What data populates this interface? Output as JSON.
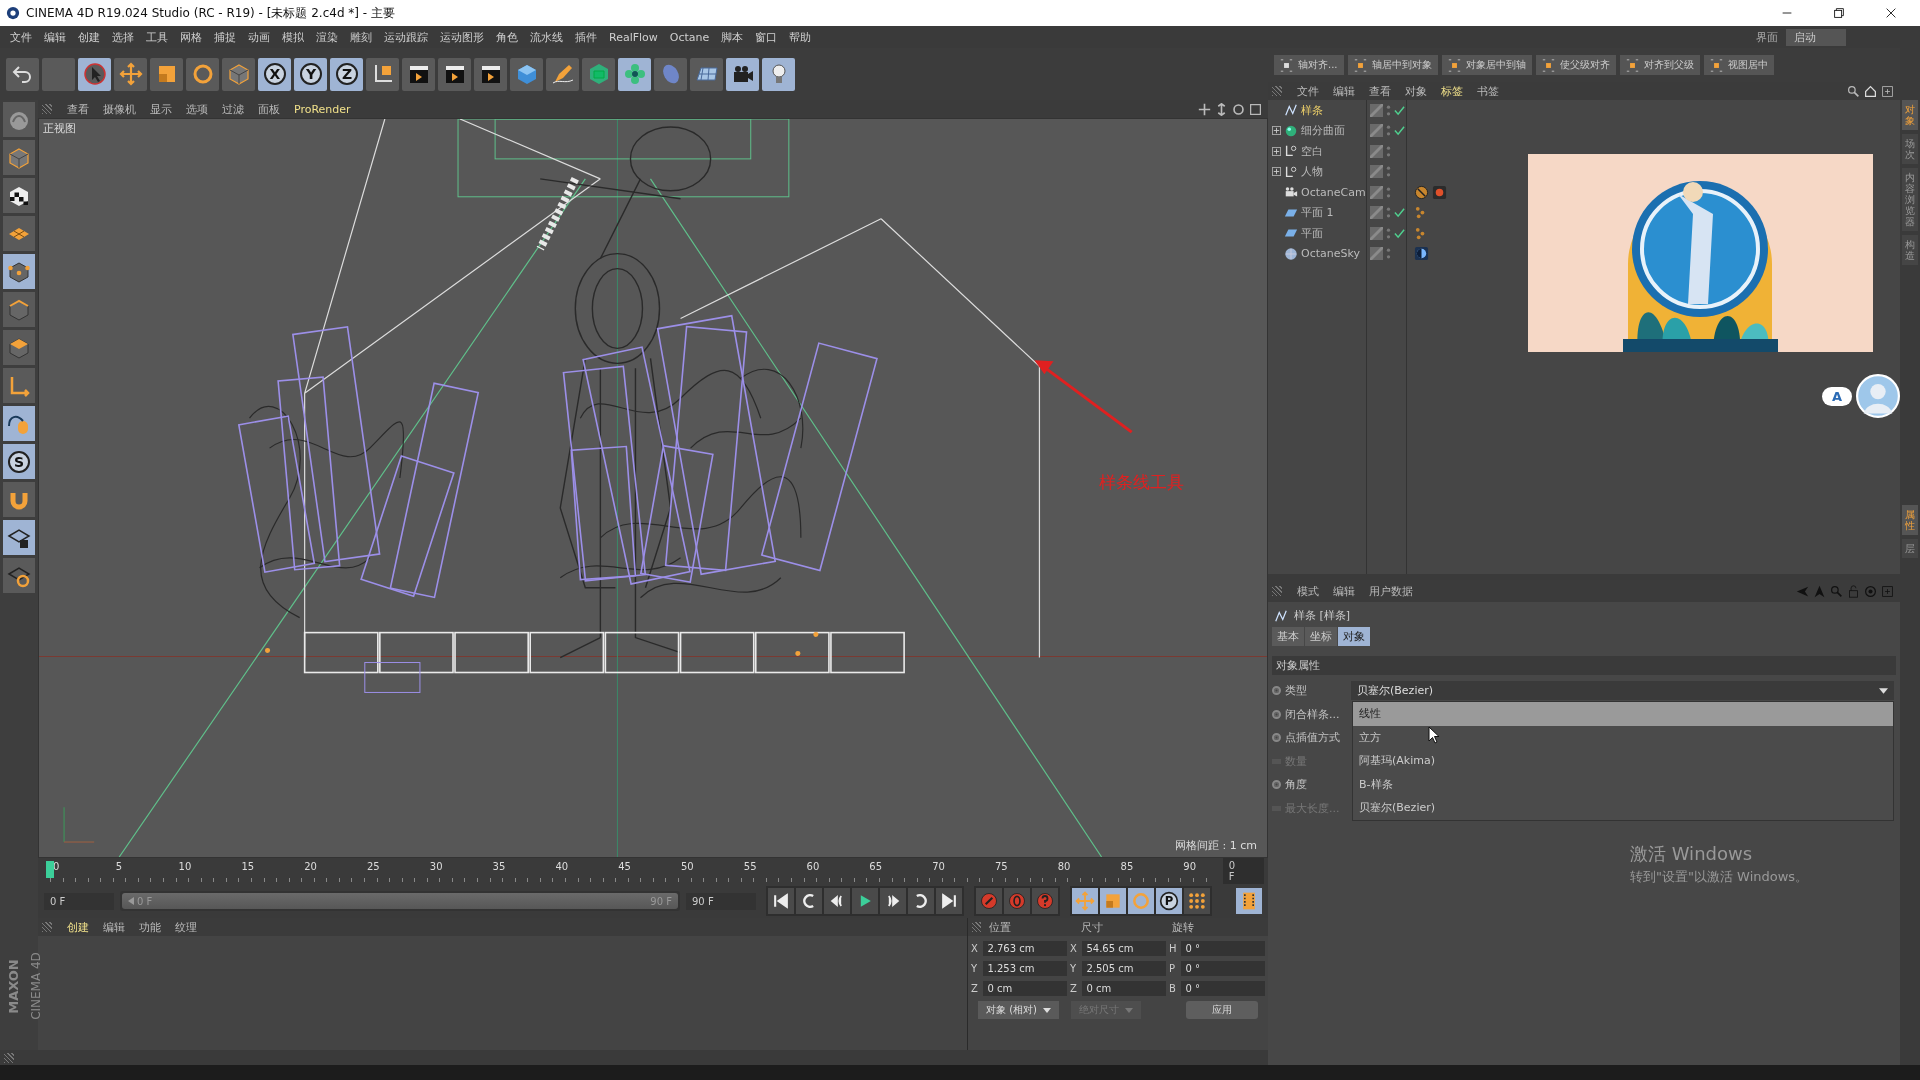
{
  "window": {
    "title": "CINEMA 4D R19.024 Studio (RC - R19) - [未标题 2.c4d *] - 主要"
  },
  "menu": [
    "文件",
    "编辑",
    "创建",
    "选择",
    "工具",
    "网格",
    "捕捉",
    "动画",
    "模拟",
    "渲染",
    "雕刻",
    "运动跟踪",
    "运动图形",
    "角色",
    "流水线",
    "插件",
    "RealFlow",
    "Octane",
    "脚本",
    "窗口",
    "帮助"
  ],
  "layout": {
    "label": "界面",
    "value": "启动"
  },
  "main_toolbar": [
    {
      "kind": "undo",
      "selected": false
    },
    {
      "kind": "empty",
      "selected": false
    },
    {
      "kind": "select",
      "selected": true
    },
    {
      "kind": "move",
      "selected": false
    },
    {
      "kind": "scale",
      "selected": false
    },
    {
      "kind": "rotate",
      "selected": false
    },
    {
      "kind": "cube-outline",
      "selected": false
    },
    {
      "kind": "axis-letter",
      "label": "X",
      "selected": true
    },
    {
      "kind": "axis-letter",
      "label": "Y",
      "selected": true
    },
    {
      "kind": "axis-letter",
      "label": "Z",
      "selected": true
    },
    {
      "kind": "coord",
      "selected": false
    },
    {
      "kind": "clapper",
      "selected": false
    },
    {
      "kind": "clapper",
      "selected": false
    },
    {
      "kind": "clapper",
      "selected": false
    },
    {
      "kind": "cube",
      "selected": false
    },
    {
      "kind": "pen",
      "selected": false
    },
    {
      "kind": "gem",
      "selected": false
    },
    {
      "kind": "flower",
      "selected": true
    },
    {
      "kind": "blob",
      "selected": false
    },
    {
      "kind": "floor",
      "selected": false
    },
    {
      "kind": "camera",
      "selected": true
    },
    {
      "kind": "bulb",
      "selected": true
    }
  ],
  "left_toolbar": [
    {
      "kind": "sculpt",
      "selected": false
    },
    {
      "kind": "cube-gray",
      "selected": false
    },
    {
      "kind": "checker",
      "selected": false
    },
    {
      "kind": "grid",
      "selected": false
    },
    {
      "kind": "cube-points",
      "selected": true
    },
    {
      "kind": "cube-edges",
      "selected": false
    },
    {
      "kind": "cube-faces",
      "selected": false
    },
    {
      "kind": "axis-l",
      "selected": false
    },
    {
      "kind": "mouse",
      "selected": true
    },
    {
      "kind": "letter-circle",
      "label": "S",
      "selected": true
    },
    {
      "kind": "magnet",
      "selected": false
    },
    {
      "kind": "grid-lock",
      "selected": true
    },
    {
      "kind": "grid-sync",
      "selected": false
    }
  ],
  "viewport": {
    "tabs": [
      {
        "label": "查看",
        "selected": false
      },
      {
        "label": "摄像机",
        "selected": false
      },
      {
        "label": "显示",
        "selected": false
      },
      {
        "label": "选项",
        "selected": false
      },
      {
        "label": "过滤",
        "selected": false
      },
      {
        "label": "面板",
        "selected": false
      },
      {
        "label": "ProRender",
        "selected": true
      }
    ],
    "view_name": "正视图",
    "grid_spacing": "网格间距 : 1 cm",
    "annotation": "样条线工具"
  },
  "timeline": {
    "ticks": [
      "0",
      "5",
      "10",
      "15",
      "20",
      "25",
      "30",
      "35",
      "40",
      "45",
      "50",
      "55",
      "60",
      "65",
      "70",
      "75",
      "80",
      "85",
      "90"
    ],
    "current_frame": "0 F"
  },
  "playback": {
    "start": "0 F",
    "range": {
      "start": "0 F",
      "end": "90 F",
      "level": 1
    },
    "end": "90 F",
    "buttons": [
      {
        "kind": "first"
      },
      {
        "kind": "prev-key"
      },
      {
        "kind": "prev-frame"
      },
      {
        "kind": "play"
      },
      {
        "kind": "next-frame"
      },
      {
        "kind": "next-key"
      },
      {
        "kind": "last"
      }
    ],
    "record_buttons": [
      {
        "kind": "record"
      },
      {
        "kind": "autokey"
      },
      {
        "kind": "question"
      }
    ],
    "key_buttons": [
      {
        "kind": "move",
        "selected": true
      },
      {
        "kind": "scale",
        "selected": true
      },
      {
        "kind": "rotate",
        "selected": true
      },
      {
        "kind": "letter-circle",
        "label": "P",
        "selected": true
      },
      {
        "kind": "dots",
        "selected": false
      }
    ]
  },
  "material_manager": {
    "tabs": [
      {
        "label": "创建",
        "selected": true
      },
      {
        "label": "编辑",
        "selected": false
      },
      {
        "label": "功能",
        "selected": false
      },
      {
        "label": "纹理",
        "selected": false
      }
    ]
  },
  "coordinates": {
    "headers": [
      "位置",
      "尺寸",
      "旋转"
    ],
    "rows": [
      {
        "axis": "X",
        "position": "2.763 cm",
        "size_axis": "X",
        "size": "54.65 cm",
        "rot_axis": "H",
        "rotation": "0 °"
      },
      {
        "axis": "Y",
        "position": "1.253 cm",
        "size_axis": "Y",
        "size": "2.505 cm",
        "rot_axis": "P",
        "rotation": "0 °"
      },
      {
        "axis": "Z",
        "position": "0 cm",
        "size_axis": "Z",
        "size": "0 cm",
        "rot_axis": "B",
        "rotation": "0 °"
      }
    ],
    "mode": "对象 (相对)",
    "size_mode": {
      "label": "绝对尺寸",
      "disabled": true
    },
    "apply": "应用"
  },
  "logo": {
    "brand": "MAXON",
    "product": "CINEMA 4D"
  },
  "align_toolbar": [
    "轴对齐...",
    "轴居中到对象",
    "对象居中到轴",
    "使父级对齐",
    "对齐到父级",
    "视图居中"
  ],
  "object_manager": {
    "menu": [
      {
        "label": "文件",
        "selected": false
      },
      {
        "label": "编辑",
        "selected": false
      },
      {
        "label": "查看",
        "selected": false
      },
      {
        "label": "对象",
        "selected": false
      },
      {
        "label": "标签",
        "selected": true
      },
      {
        "label": "书签",
        "selected": false
      }
    ],
    "objects": [
      {
        "name": "样条",
        "kind": "spline",
        "selected": true,
        "expandable": false,
        "checked": true
      },
      {
        "name": "细分曲面",
        "kind": "subdiv",
        "selected": false,
        "expandable": true,
        "checked": true
      },
      {
        "name": "空白",
        "kind": "null",
        "selected": false,
        "expandable": true,
        "checked": false
      },
      {
        "name": "人物",
        "kind": "null",
        "selected": false,
        "expandable": true,
        "checked": false
      },
      {
        "name": "OctaneCam",
        "kind": "camera",
        "selected": false,
        "expandable": false,
        "checked": false,
        "tags": [
          {
            "kind": "no-render"
          },
          {
            "kind": "cam-tag"
          }
        ]
      },
      {
        "name": "平面 1",
        "kind": "plane",
        "selected": false,
        "expandable": false,
        "checked": true,
        "tags": [
          {
            "kind": "dots"
          }
        ]
      },
      {
        "name": "平面",
        "kind": "plane",
        "selected": false,
        "expandable": false,
        "checked": true,
        "tags": [
          {
            "kind": "dots"
          }
        ]
      },
      {
        "name": "OctaneSky",
        "kind": "sky",
        "selected": false,
        "expandable": false,
        "checked": false,
        "tags": [
          {
            "kind": "sky-tag"
          }
        ]
      }
    ]
  },
  "attributes": {
    "menu": [
      "模式",
      "编辑",
      "用户数据"
    ],
    "title": "样条 [样条]",
    "tabs": [
      {
        "label": "基本",
        "selected": false
      },
      {
        "label": "坐标",
        "selected": false
      },
      {
        "label": "对象",
        "selected": true
      }
    ],
    "section": "对象属性",
    "properties": [
      {
        "label": "类型",
        "disabled": false
      },
      {
        "label": "闭合样条...",
        "disabled": false
      },
      {
        "label": "点插值方式",
        "disabled": false
      },
      {
        "label": "数量",
        "disabled": true
      },
      {
        "label": "角度",
        "disabled": false
      },
      {
        "label": "最大长度...",
        "disabled": true
      }
    ],
    "type_value": "贝塞尔(Bezier)",
    "options": [
      {
        "label": "线性",
        "selected": true
      },
      {
        "label": "立方",
        "selected": false
      },
      {
        "label": "阿基玛(Akima)",
        "selected": false
      },
      {
        "label": "B-样条",
        "selected": false
      },
      {
        "label": "贝塞尔(Bezier)",
        "selected": false
      }
    ]
  },
  "side_tabs_top": [
    {
      "label": "对象",
      "selected": true
    },
    {
      "label": "场次",
      "selected": false
    },
    {
      "label": "内容浏览器",
      "selected": false
    },
    {
      "label": "构造",
      "selected": false
    }
  ],
  "side_tabs_bottom": [
    {
      "label": "属性",
      "selected": true
    },
    {
      "label": "层",
      "selected": false
    }
  ],
  "assistant": {
    "label": "A"
  },
  "activation": {
    "title": "激活 Windows",
    "subtitle": "转到\"设置\"以激活 Windows。"
  }
}
